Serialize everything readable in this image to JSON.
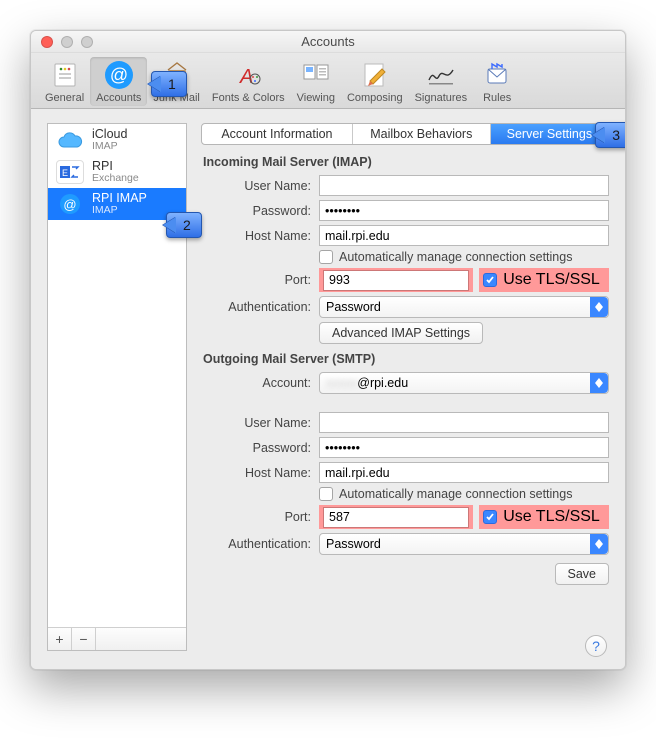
{
  "title": "Accounts",
  "toolbar": [
    {
      "label": "General"
    },
    {
      "label": "Accounts"
    },
    {
      "label": "Junk Mail"
    },
    {
      "label": "Fonts & Colors"
    },
    {
      "label": "Viewing"
    },
    {
      "label": "Composing"
    },
    {
      "label": "Signatures"
    },
    {
      "label": "Rules"
    }
  ],
  "sidebar": {
    "items": [
      {
        "title": "iCloud",
        "sub": "IMAP"
      },
      {
        "title": "RPI",
        "sub": "Exchange"
      },
      {
        "title": "RPI IMAP",
        "sub": "IMAP"
      }
    ],
    "add": "+",
    "remove": "−"
  },
  "tabs": {
    "t1": "Account Information",
    "t2": "Mailbox Behaviors",
    "t3": "Server Settings"
  },
  "incoming": {
    "title": "Incoming Mail Server (IMAP)",
    "username_label": "User Name:",
    "username_value": "",
    "password_label": "Password:",
    "password_value": "••••••••",
    "hostname_label": "Host Name:",
    "hostname_value": "mail.rpi.edu",
    "auto_label": "Automatically manage connection settings",
    "port_label": "Port:",
    "port_value": "993",
    "tls_label": "Use TLS/SSL",
    "auth_label": "Authentication:",
    "auth_value": "Password",
    "adv_btn": "Advanced IMAP Settings"
  },
  "outgoing": {
    "title": "Outgoing Mail Server (SMTP)",
    "account_label": "Account:",
    "account_value": "@rpi.edu",
    "username_label": "User Name:",
    "username_value": "",
    "password_label": "Password:",
    "password_value": "••••••••",
    "hostname_label": "Host Name:",
    "hostname_value": "mail.rpi.edu",
    "auto_label": "Automatically manage connection settings",
    "port_label": "Port:",
    "port_value": "587",
    "tls_label": "Use TLS/SSL",
    "auth_label": "Authentication:",
    "auth_value": "Password"
  },
  "save_label": "Save",
  "callouts": {
    "c1": "1",
    "c2": "2",
    "c3": "3"
  },
  "help": "?"
}
